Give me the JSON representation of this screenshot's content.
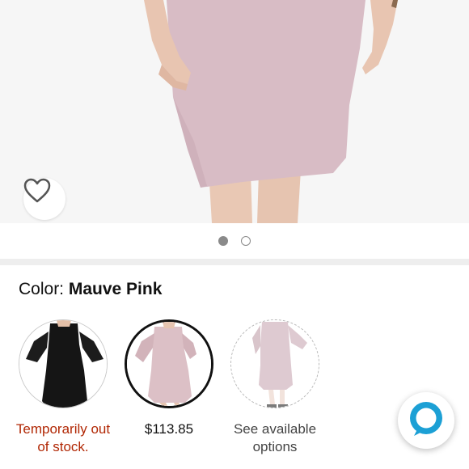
{
  "product": {
    "image_carousel": {
      "total_images": 2,
      "active_index": 0
    },
    "wishlist_icon": "heart-outline-icon"
  },
  "color_selector": {
    "label": "Color:",
    "selected_value": "Mauve Pink",
    "options": [
      {
        "status": "Temporarily out of stock.",
        "line1": "Temporarily out",
        "line2": "of stock.",
        "swatch_color": "#151515"
      },
      {
        "status": "$113.85",
        "line1": "$113.85",
        "line2": "",
        "swatch_color": "#dcc0c6"
      },
      {
        "status": "See available options",
        "line1": "See available",
        "line2": "options",
        "swatch_color": "#c9a7b3"
      }
    ]
  },
  "colors": {
    "out_of_stock": "#b12704",
    "dress": "#d7bcc4",
    "alexa_accent": "#1ca0d5"
  },
  "assistant_button": {
    "icon": "alexa-icon"
  }
}
